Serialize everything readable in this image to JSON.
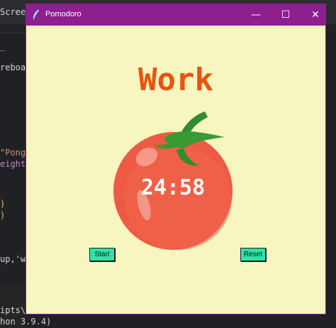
{
  "window": {
    "title": "Pomodoro",
    "titlebar_color": "#8e1f8e",
    "background_color": "#f7f5c0",
    "controls": {
      "minimize": "—",
      "maximize": "☐",
      "close": "✕"
    }
  },
  "main": {
    "heading": "Work",
    "heading_color": "#e8540e",
    "timer": "24:58",
    "start_label": "Start",
    "reset_label": "Reset",
    "button_color": "#2ee3a5"
  },
  "background_editor": {
    "tab_fragment": "Scree",
    "lines": [
      "reboar",
      "\"Pong_",
      "eight=",
      ")",
      "up,'w",
      "ipts\\",
      "hon 3.9.4)"
    ]
  }
}
